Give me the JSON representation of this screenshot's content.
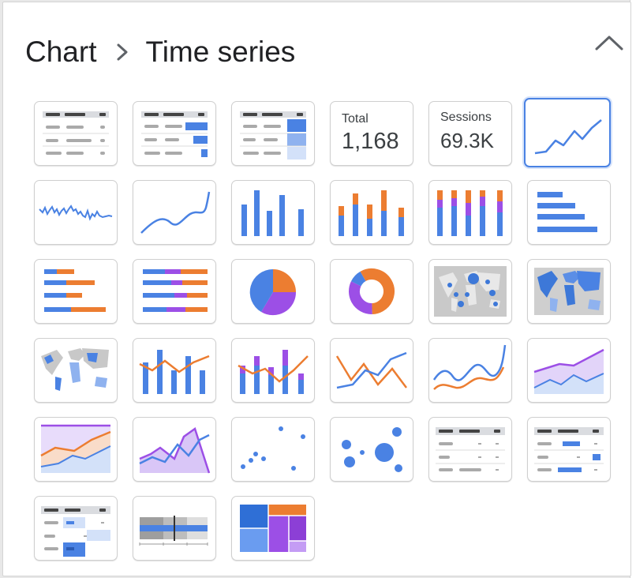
{
  "header": {
    "breadcrumb_parent": "Chart",
    "breadcrumb_current": "Time series",
    "collapse_icon": "chevron-up-icon"
  },
  "colors": {
    "blue": "#4a82e3",
    "orange": "#ec7d31",
    "purple": "#9c4fe6",
    "gray": "#b5b5b5",
    "dark_gray": "#5f6368",
    "selected_border": "#4a82e3"
  },
  "chart_types": [
    {
      "name": "table",
      "selected": false
    },
    {
      "name": "table-with-bars",
      "selected": false
    },
    {
      "name": "table-with-heatmap",
      "selected": false
    },
    {
      "name": "scorecard",
      "label": "Total",
      "value": "1,168",
      "selected": false
    },
    {
      "name": "scorecard-compact",
      "label": "Sessions",
      "value": "69.3K",
      "selected": false
    },
    {
      "name": "time-series",
      "selected": true
    },
    {
      "name": "sparkline",
      "selected": false
    },
    {
      "name": "smoothed-time-series",
      "selected": false
    },
    {
      "name": "column-chart",
      "selected": false
    },
    {
      "name": "stacked-column-chart",
      "selected": false
    },
    {
      "name": "100-percent-stacked-column-chart",
      "selected": false
    },
    {
      "name": "bar-chart",
      "selected": false
    },
    {
      "name": "stacked-bar-chart",
      "selected": false
    },
    {
      "name": "100-percent-stacked-bar-chart",
      "selected": false
    },
    {
      "name": "pie-chart",
      "selected": false
    },
    {
      "name": "donut-chart",
      "selected": false
    },
    {
      "name": "bubble-map",
      "selected": false
    },
    {
      "name": "filled-map",
      "selected": false
    },
    {
      "name": "geo-chart",
      "selected": false
    },
    {
      "name": "combo-chart",
      "selected": false
    },
    {
      "name": "stacked-combo-chart",
      "selected": false
    },
    {
      "name": "line-chart",
      "selected": false
    },
    {
      "name": "smoothed-line-chart",
      "selected": false
    },
    {
      "name": "area-chart",
      "selected": false
    },
    {
      "name": "stacked-area-chart",
      "selected": false
    },
    {
      "name": "100-percent-stacked-area-chart",
      "selected": false
    },
    {
      "name": "scatter-chart",
      "selected": false
    },
    {
      "name": "bubble-chart",
      "selected": false
    },
    {
      "name": "pivot-table",
      "selected": false
    },
    {
      "name": "pivot-table-with-bars",
      "selected": false
    },
    {
      "name": "pivot-table-with-heatmap",
      "selected": false
    },
    {
      "name": "bullet-chart",
      "selected": false
    },
    {
      "name": "treemap",
      "selected": false
    }
  ]
}
